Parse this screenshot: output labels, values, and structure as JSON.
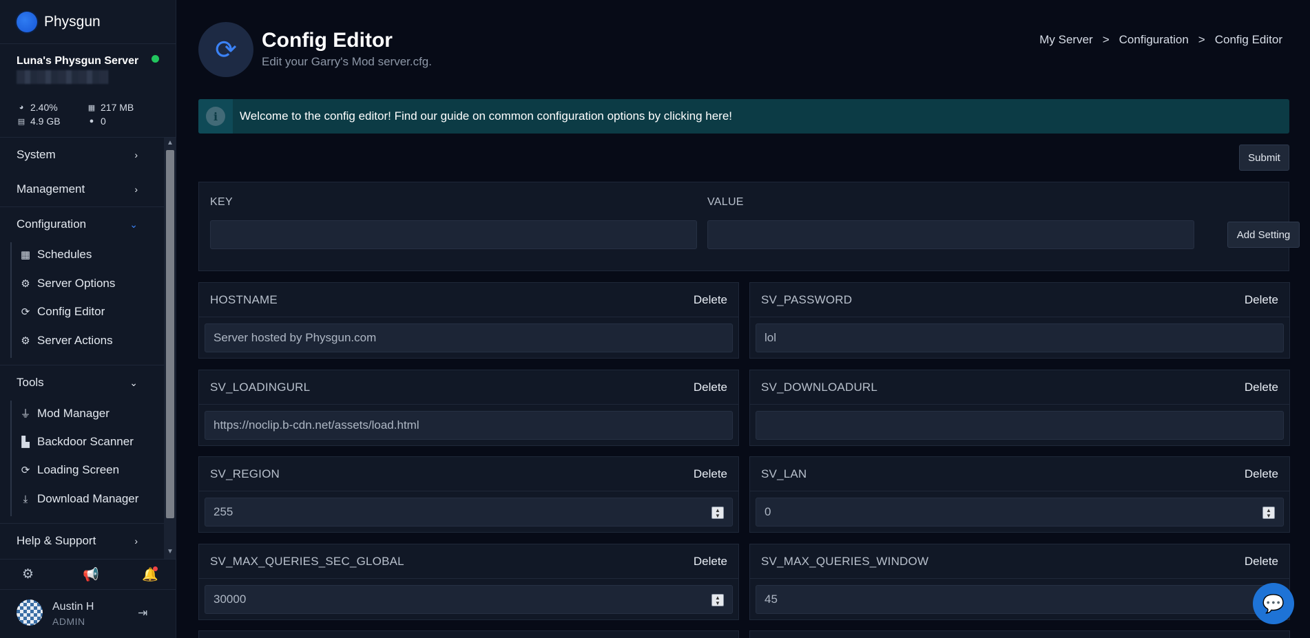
{
  "brand": {
    "name": "Physgun",
    "logo_icon": "physgun-logo-icon"
  },
  "server": {
    "name": "Luna's Physgun Server",
    "status": "online",
    "status_color": "#22c55e",
    "stats": {
      "cpu": "2.40%",
      "memory": "217 MB",
      "disk": "4.9 GB",
      "players": "0"
    }
  },
  "nav": {
    "system": "System",
    "management": "Management",
    "configuration": "Configuration",
    "configuration_items": [
      "Schedules",
      "Server Options",
      "Config Editor",
      "Server Actions"
    ],
    "tools": "Tools",
    "tools_items": [
      "Mod Manager",
      "Backdoor Scanner",
      "Loading Screen",
      "Download Manager"
    ],
    "help": "Help & Support"
  },
  "user": {
    "name": "Austin H",
    "role": "ADMIN"
  },
  "page": {
    "title": "Config Editor",
    "subtitle": "Edit your Garry's Mod server.cfg.",
    "breadcrumb": [
      "My Server",
      "Configuration",
      "Config Editor"
    ],
    "breadcrumb_sep": ">"
  },
  "alert": {
    "text": "Welcome to the config editor! Find our guide on common configuration options by clicking here!",
    "color": "#0c3b45"
  },
  "actions": {
    "submit": "Submit",
    "add_setting": "Add Setting",
    "delete": "Delete"
  },
  "add_form": {
    "key_label": "KEY",
    "value_label": "VALUE",
    "key_value": "",
    "value_value": ""
  },
  "settings": [
    {
      "key": "HOSTNAME",
      "value": "Server hosted by Physgun.com",
      "type": "text"
    },
    {
      "key": "SV_PASSWORD",
      "value": "lol",
      "type": "text"
    },
    {
      "key": "SV_LOADINGURL",
      "value": "https://noclip.b-cdn.net/assets/load.html",
      "type": "text"
    },
    {
      "key": "SV_DOWNLOADURL",
      "value": "",
      "type": "text"
    },
    {
      "key": "SV_REGION",
      "value": "255",
      "type": "number"
    },
    {
      "key": "SV_LAN",
      "value": "0",
      "type": "number"
    },
    {
      "key": "SV_MAX_QUERIES_SEC_GLOBAL",
      "value": "30000",
      "type": "number"
    },
    {
      "key": "SV_MAX_QUERIES_WINDOW",
      "value": "45",
      "type": "number"
    }
  ],
  "colors": {
    "accent": "#3b82f6",
    "background": "#070b17",
    "sidebar": "#111826"
  }
}
